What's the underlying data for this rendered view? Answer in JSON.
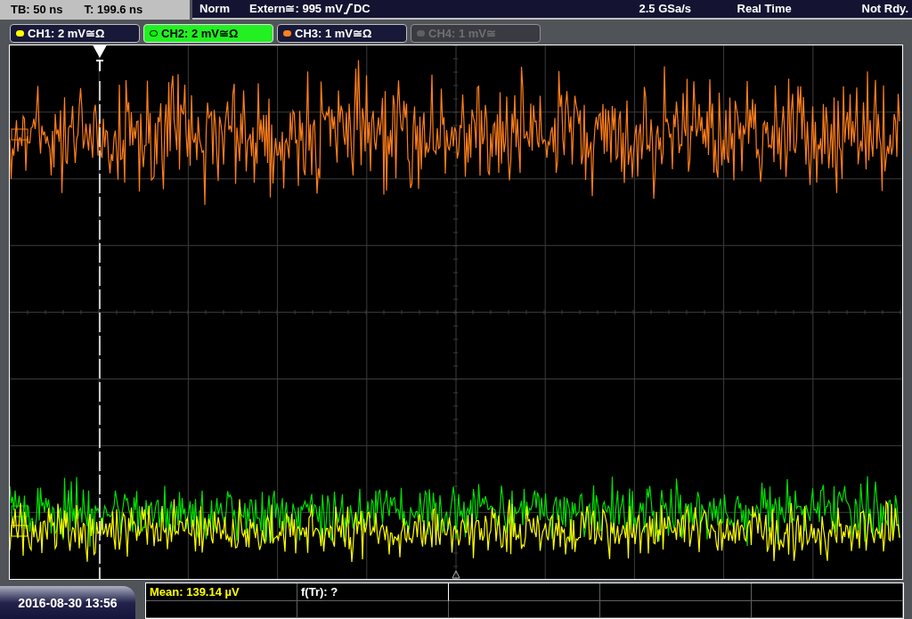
{
  "status_bar": {
    "timebase": "TB: 50 ns",
    "trigger_time": "T: 199.6 ns",
    "trigger_mode": "Norm",
    "trigger_source": "Extern≅: 995 mV",
    "trigger_coupling": "DC",
    "sample_rate": "2.5 GSa/s",
    "acquisition": "Real Time",
    "state": "Not Rdy."
  },
  "channels": [
    {
      "label": "CH1: 2 mV≅Ω",
      "color": "#ffff00",
      "selected": false,
      "disabled": false
    },
    {
      "label": "CH2: 2 mV≅Ω",
      "color": "#00ff00",
      "selected": true,
      "disabled": false
    },
    {
      "label": "CH3: 1 mV≅Ω",
      "color": "#ff8020",
      "selected": false,
      "disabled": false
    },
    {
      "label": "CH4: 1 mV≅",
      "color": "#606060",
      "selected": false,
      "disabled": true
    }
  ],
  "traces": [
    {
      "color": "#ff7f1a"
    },
    {
      "color": "#00e000"
    },
    {
      "color": "#ffff00"
    }
  ],
  "measurements": [
    {
      "text": "Mean: 139.14 µV",
      "color": "#ffff00"
    },
    {
      "text": "f(Tr): ?",
      "color": "#ffffff"
    }
  ],
  "timestamp": "2016-08-30 13:56"
}
